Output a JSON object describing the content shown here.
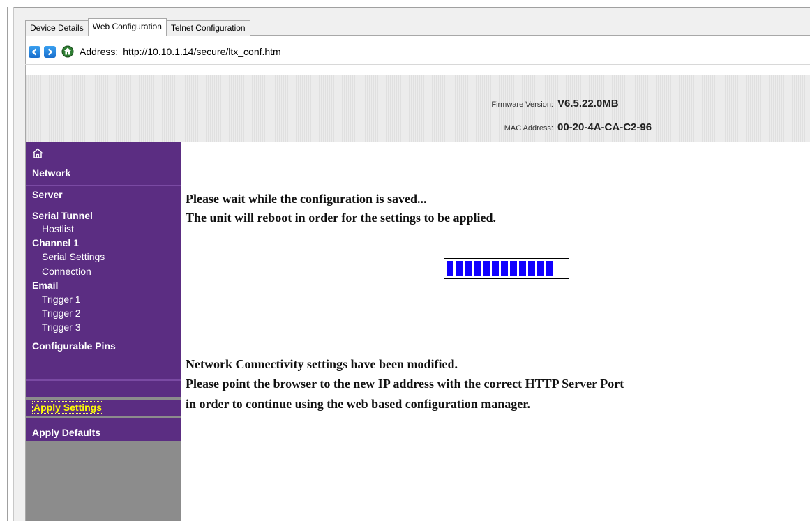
{
  "tabs": [
    {
      "label": "Device Details",
      "active": false
    },
    {
      "label": "Web Configuration",
      "active": true
    },
    {
      "label": "Telnet Configuration",
      "active": false
    }
  ],
  "address_bar": {
    "label": "Address:",
    "url": "http://10.10.1.14/secure/ltx_conf.htm",
    "icons": [
      "back-arrow-icon",
      "forward-arrow-icon",
      "home-icon"
    ]
  },
  "header": {
    "firmware_label": "Firmware Version:",
    "firmware_value": "V6.5.22.0MB",
    "mac_label": "MAC Address:",
    "mac_value": "00-20-4A-CA-C2-96"
  },
  "sidebar": {
    "home_icon": "house-icon",
    "items": [
      {
        "label": "Network",
        "level": "main"
      },
      {
        "label": "Server",
        "level": "main"
      },
      {
        "label": "Serial Tunnel",
        "level": "main"
      },
      {
        "label": "Hostlist",
        "level": "sub"
      },
      {
        "label": "Channel 1",
        "level": "main"
      },
      {
        "label": "Serial Settings",
        "level": "sub"
      },
      {
        "label": "Connection",
        "level": "sub"
      },
      {
        "label": "Email",
        "level": "main"
      },
      {
        "label": "Trigger 1",
        "level": "sub"
      },
      {
        "label": "Trigger 2",
        "level": "sub"
      },
      {
        "label": "Trigger 3",
        "level": "sub"
      },
      {
        "label": "Configurable Pins",
        "level": "main"
      },
      {
        "label": "Apply Settings",
        "level": "main",
        "highlighted": true
      },
      {
        "label": "Apply Defaults",
        "level": "main"
      }
    ],
    "colors": {
      "item_bg": "#5b2d82",
      "panel_bg": "#8c8c8c",
      "highlight_text": "#ffff00"
    }
  },
  "main": {
    "saving_line1": "Please wait while the configuration is saved...",
    "saving_line2": "The unit will reboot in order for the settings to be applied.",
    "progress": {
      "segments_filled": 12,
      "color": "#1100ff"
    },
    "notice_line1": "Network Connectivity settings have been modified.",
    "notice_line2": "Please point the browser to the new IP address with the correct HTTP Server Port",
    "notice_line3": "in order to continue using the web based configuration manager."
  }
}
